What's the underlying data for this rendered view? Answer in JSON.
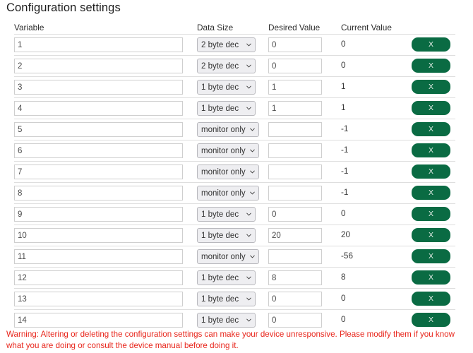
{
  "page": {
    "title": "Configuration settings"
  },
  "table": {
    "headers": {
      "variable": "Variable",
      "data_size": "Data Size",
      "desired_value": "Desired Value",
      "current_value": "Current Value"
    },
    "delete_label": "X",
    "data_size_options": [
      "1 byte dec",
      "2 byte dec",
      "monitor only"
    ],
    "rows": [
      {
        "variable": "1",
        "data_size": "2 byte dec",
        "desired_value": "0",
        "current_value": "0",
        "desired_enabled": true
      },
      {
        "variable": "2",
        "data_size": "2 byte dec",
        "desired_value": "0",
        "current_value": "0",
        "desired_enabled": true
      },
      {
        "variable": "3",
        "data_size": "1 byte dec",
        "desired_value": "1",
        "current_value": "1",
        "desired_enabled": true
      },
      {
        "variable": "4",
        "data_size": "1 byte dec",
        "desired_value": "1",
        "current_value": "1",
        "desired_enabled": true
      },
      {
        "variable": "5",
        "data_size": "monitor only",
        "desired_value": "",
        "current_value": "-1",
        "desired_enabled": false
      },
      {
        "variable": "6",
        "data_size": "monitor only",
        "desired_value": "",
        "current_value": "-1",
        "desired_enabled": false
      },
      {
        "variable": "7",
        "data_size": "monitor only",
        "desired_value": "",
        "current_value": "-1",
        "desired_enabled": false
      },
      {
        "variable": "8",
        "data_size": "monitor only",
        "desired_value": "",
        "current_value": "-1",
        "desired_enabled": false
      },
      {
        "variable": "9",
        "data_size": "1 byte dec",
        "desired_value": "0",
        "current_value": "0",
        "desired_enabled": true
      },
      {
        "variable": "10",
        "data_size": "1 byte dec",
        "desired_value": "20",
        "current_value": "20",
        "desired_enabled": true
      },
      {
        "variable": "11",
        "data_size": "monitor only",
        "desired_value": "",
        "current_value": "-56",
        "desired_enabled": false
      },
      {
        "variable": "12",
        "data_size": "1 byte dec",
        "desired_value": "8",
        "current_value": "8",
        "desired_enabled": true
      },
      {
        "variable": "13",
        "data_size": "1 byte dec",
        "desired_value": "0",
        "current_value": "0",
        "desired_enabled": true
      },
      {
        "variable": "14",
        "data_size": "1 byte dec",
        "desired_value": "0",
        "current_value": "0",
        "desired_enabled": true
      }
    ]
  },
  "warning": {
    "text": "Warning: Altering or deleting the configuration settings can make your device unresponsive. Please modify them if you know what you are doing or consult the device manual before doing it."
  },
  "colors": {
    "accent_green": "#0a6b43",
    "warning_red": "#e8261c",
    "rule": "#dedede"
  }
}
